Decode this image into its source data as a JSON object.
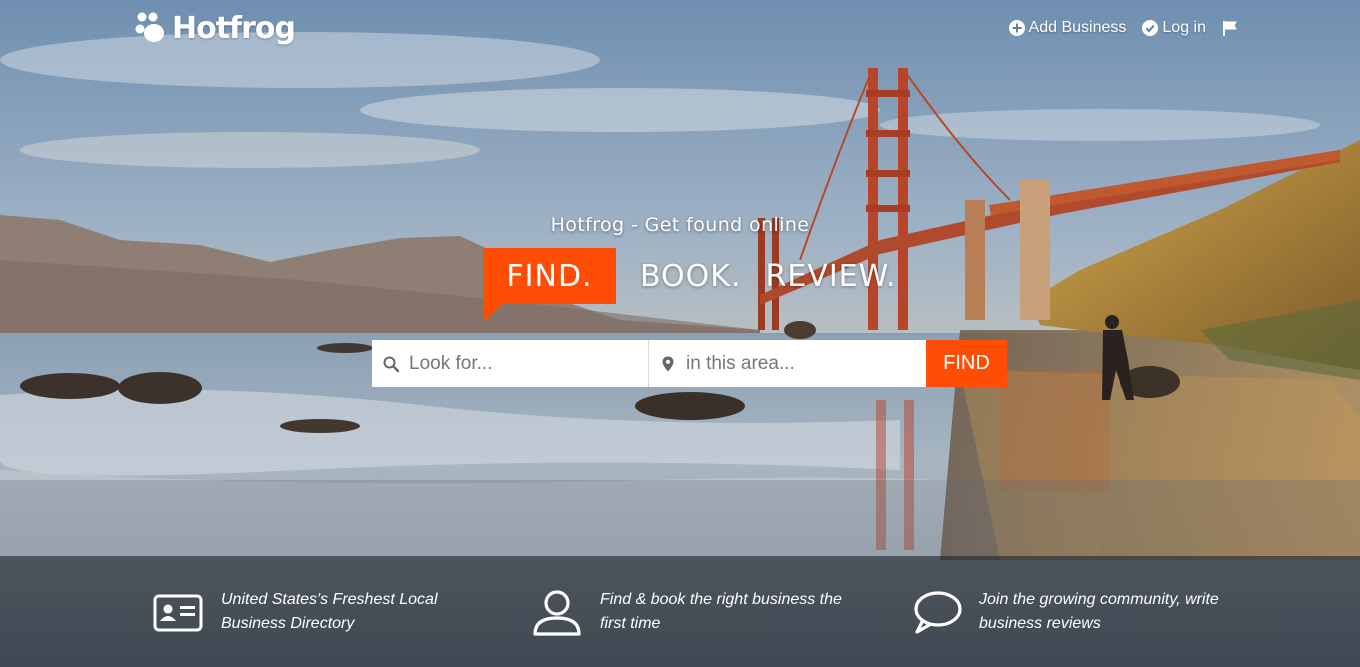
{
  "brand": {
    "name": "Hotfrog",
    "logo_icon": "frog-paw-icon"
  },
  "nav": {
    "add_business": "Add Business",
    "login": "Log in",
    "flag_icon": "flag-icon"
  },
  "hero": {
    "tagline": "Hotfrog - Get found online",
    "slogan": [
      "FIND.",
      "BOOK.",
      "REVIEW."
    ]
  },
  "search": {
    "what_placeholder": "Look for...",
    "where_placeholder": "in this area...",
    "what_value": "",
    "where_value": "",
    "button_label": "FIND"
  },
  "features": [
    {
      "icon": "id-card-icon",
      "text": "United States's Freshest Local Business Directory"
    },
    {
      "icon": "user-icon",
      "text": "Find & book the right business the first time"
    },
    {
      "icon": "chat-bubble-icon",
      "text": "Join the growing community, write business reviews"
    }
  ],
  "colors": {
    "accent": "#ff4d05",
    "text": "#ffffff"
  }
}
